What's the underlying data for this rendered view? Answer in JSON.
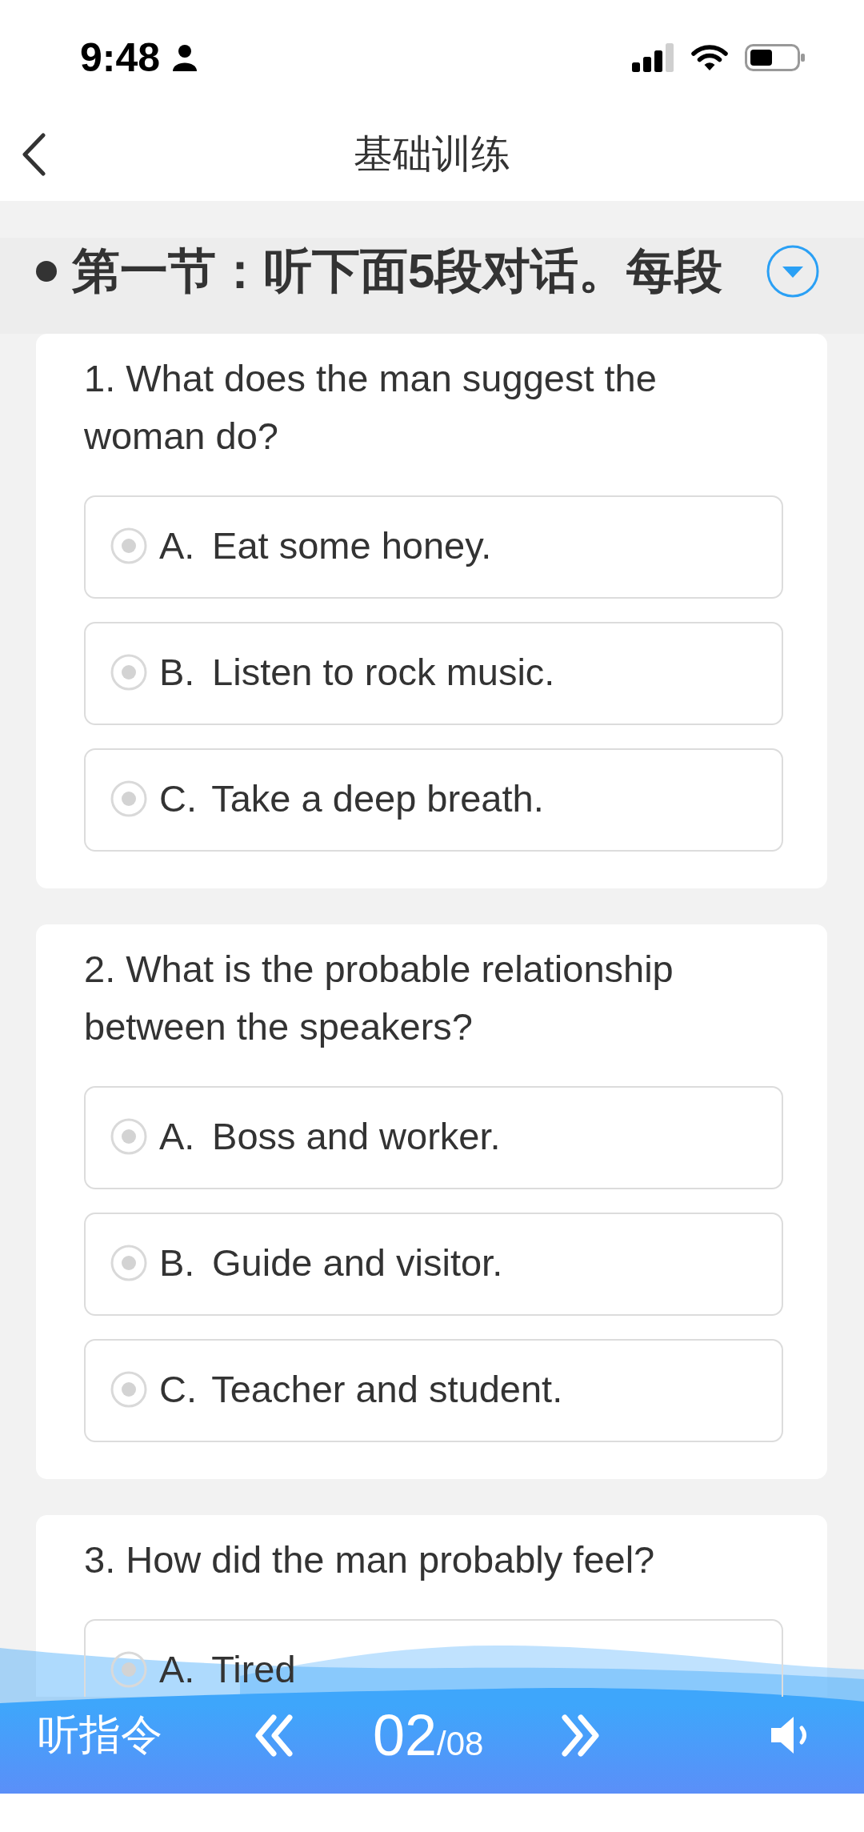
{
  "status_bar": {
    "time": "9:48"
  },
  "nav": {
    "title": "基础训练"
  },
  "section": {
    "title": "第一节：听下面5段对话。每段"
  },
  "questions": [
    {
      "text": "1. What does the man suggest the woman do?",
      "options": [
        {
          "letter": "A.",
          "text": "Eat some honey.",
          "selected": false
        },
        {
          "letter": "B.",
          "text": "Listen to rock music.",
          "selected": false
        },
        {
          "letter": "C.",
          "text": "Take a deep breath.",
          "selected": false
        }
      ]
    },
    {
      "text": "2. What is the probable relationship between the speakers?",
      "options": [
        {
          "letter": "A.",
          "text": "Boss and worker.",
          "selected": false
        },
        {
          "letter": "B.",
          "text": "Guide and visitor.",
          "selected": false
        },
        {
          "letter": "C.",
          "text": "Teacher and student.",
          "selected": false
        }
      ]
    },
    {
      "text": "3. How did the man probably feel?",
      "options": [
        {
          "letter": "A.",
          "text": "Tired",
          "selected": false
        }
      ]
    }
  ],
  "player": {
    "label": "听指令",
    "current": "02",
    "total": "/08"
  }
}
